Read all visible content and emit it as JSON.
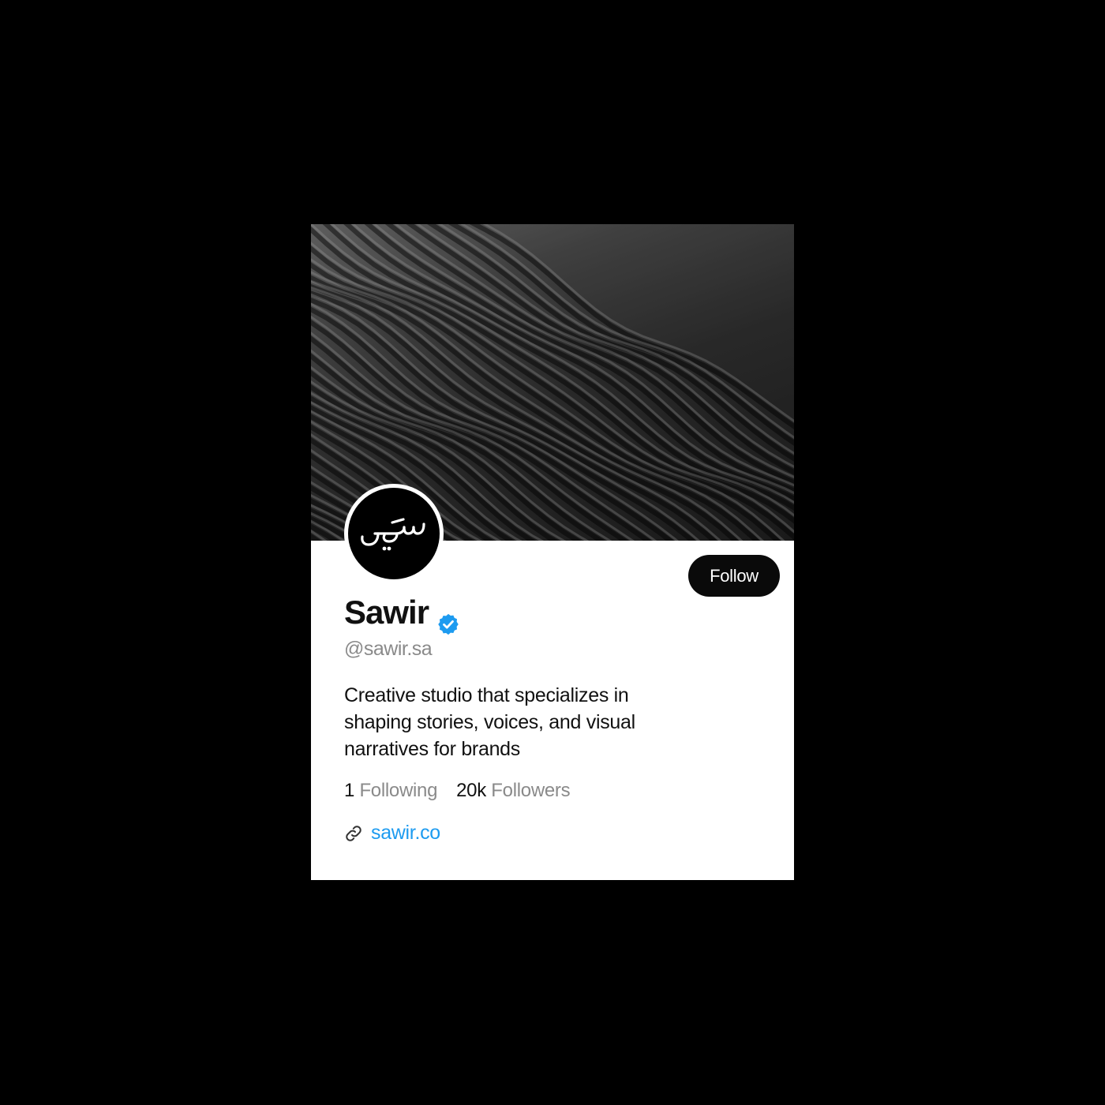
{
  "profile": {
    "avatar_logo_text": "سوير",
    "follow_label": "Follow",
    "display_name": "Sawir",
    "verified_icon": "verified-badge-icon",
    "handle": "@sawir.sa",
    "bio": "Creative studio that specializes in shaping stories, voices, and visual narratives for brands",
    "stats": [
      {
        "count": "1",
        "label": "Following"
      },
      {
        "count": "20k",
        "label": "Followers"
      }
    ],
    "link_icon": "link-icon",
    "website": "sawir.co"
  },
  "colors": {
    "page_background": "#000000",
    "card_background": "#ffffff",
    "follow_button": "#0a0a0a",
    "verified": "#1d9bf0",
    "link": "#1d9bf0",
    "secondary_text": "#8a8a8a"
  }
}
